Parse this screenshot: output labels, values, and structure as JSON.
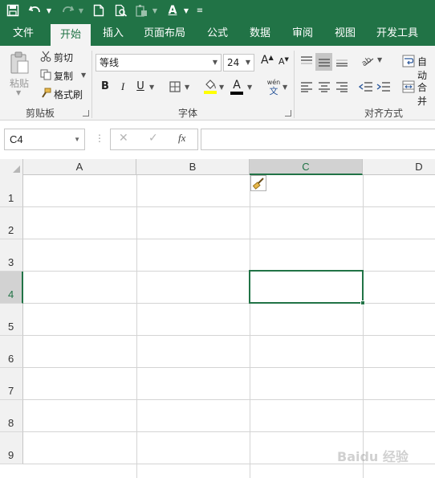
{
  "qat": {
    "icons": [
      "save-icon",
      "undo-icon",
      "redo-icon",
      "new-file-icon",
      "print-preview-icon",
      "paste-icon",
      "font-color-icon",
      "customize-icon"
    ]
  },
  "tabs": [
    "文件",
    "开始",
    "插入",
    "页面布局",
    "公式",
    "数据",
    "审阅",
    "视图",
    "开发工具"
  ],
  "active_tab": "开始",
  "ribbon": {
    "clipboard": {
      "paste_label": "粘贴",
      "cut_label": "剪切",
      "copy_label": "复制",
      "format_painter_label": "格式刷",
      "group_label": "剪贴板"
    },
    "font": {
      "font_name": "等线",
      "font_size": "24",
      "bold": "B",
      "italic": "I",
      "underline": "U",
      "font_color_glyph": "A",
      "phonetic_glyph": "wén",
      "phonetic_char": "文",
      "grow": "A",
      "shrink": "A",
      "group_label": "字体"
    },
    "alignment": {
      "wrap_label": "自动",
      "merge_label": "合并",
      "group_label": "对齐方式"
    }
  },
  "formula_bar": {
    "name_box": "C4",
    "cancel_glyph": "✕",
    "enter_glyph": "✓",
    "fx_label": "fx",
    "formula": ""
  },
  "sheet": {
    "columns": [
      "A",
      "B",
      "C",
      "D"
    ],
    "rows": [
      "1",
      "2",
      "3",
      "4",
      "5",
      "6",
      "7",
      "8",
      "9"
    ],
    "selected_column": "C",
    "selected_row": "4",
    "active_cell": "C4"
  },
  "colors": {
    "accent": "#217346",
    "ribbon_bg": "#f3f3f3",
    "header_bg": "#f1f1f1"
  },
  "watermark": "Baidu 经验"
}
